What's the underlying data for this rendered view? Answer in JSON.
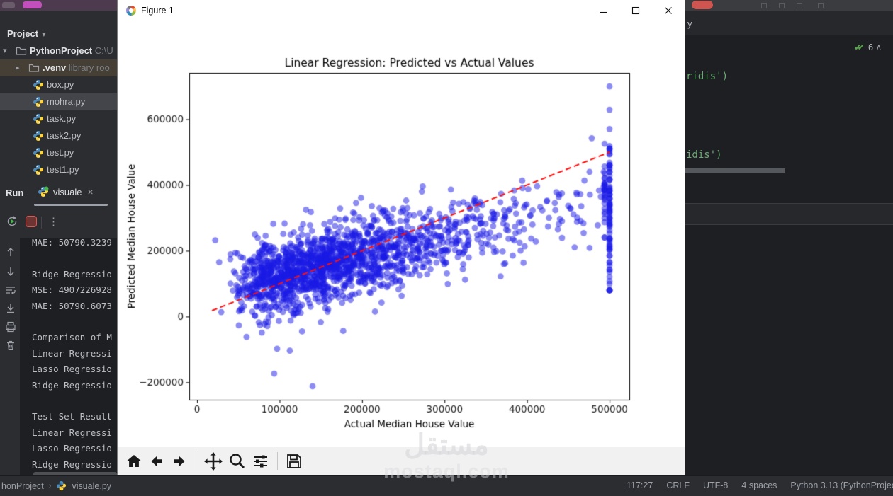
{
  "pycharm": {
    "project_panel": {
      "title": "Project",
      "items": [
        {
          "label": "PythonProject",
          "suffix": "C:\\U",
          "type": "folder",
          "depth": 0,
          "expanded": true,
          "bold": true
        },
        {
          "label": ".venv",
          "suffix": "library roo",
          "type": "folder",
          "depth": 1,
          "expanded": false,
          "bold": true,
          "highlight": "venv"
        },
        {
          "label": "box.py",
          "type": "python",
          "depth": 2
        },
        {
          "label": "mohra.py",
          "type": "python",
          "depth": 2,
          "selected": true
        },
        {
          "label": "task.py",
          "type": "python",
          "depth": 2
        },
        {
          "label": "task2.py",
          "type": "python",
          "depth": 2
        },
        {
          "label": "test.py",
          "type": "python",
          "depth": 2
        },
        {
          "label": "test1.py",
          "type": "python",
          "depth": 2
        }
      ]
    },
    "run_panel": {
      "label": "Run",
      "tab": "visuale",
      "close_tab_glyph": "×",
      "more_glyph": "⋮",
      "console_lines": [
        "MAE: 50790.3239",
        "",
        "Ridge Regressio",
        "MSE: 4907226928",
        "MAE: 50790.6073",
        "",
        "Comparison of M",
        "Linear Regressi",
        "Lasso Regressio",
        "Ridge Regressio",
        "",
        "Test Set Result",
        "Linear Regressi",
        "Lasso Regressio",
        "Ridge Regressio"
      ]
    },
    "editor": {
      "tab_tail": "y",
      "inspections_checks": "✔✔",
      "inspections_count": "6",
      "caret_up": "∧",
      "code_line_1": "ridis')",
      "code_line_2": "idis')"
    },
    "status_bar": {
      "breadcrumb_project": "honProject",
      "breadcrumb_sep": "›",
      "breadcrumb_file": "visuale.py",
      "right": [
        "117:27",
        "CRLF",
        "UTF-8",
        "4 spaces",
        "Python 3.13 (PythonProjec"
      ]
    }
  },
  "figure_window": {
    "title": "Figure 1",
    "toolbar_icons": [
      "home",
      "back",
      "forward",
      "pan",
      "zoom",
      "configure-subplots",
      "save"
    ]
  },
  "chart_data": {
    "type": "scatter",
    "title": "Linear Regression: Predicted vs Actual Values",
    "xlabel": "Actual Median House Value",
    "ylabel": "Predicted Median House Value",
    "x_ticks": [
      0,
      100000,
      200000,
      300000,
      400000,
      500000
    ],
    "y_ticks": [
      -200000,
      0,
      200000,
      400000,
      600000
    ],
    "xlim": [
      -9500,
      524000
    ],
    "ylim": [
      -253000,
      741000
    ],
    "grid": false,
    "marker_color": "#1919e6",
    "marker_alpha": 0.5,
    "marker_radius_px": 4.4,
    "identity_line": {
      "color": "#ff0f0f",
      "style": "dashed",
      "x": [
        18000,
        500000
      ],
      "y": [
        18000,
        500000
      ]
    },
    "generator": {
      "seed": 11,
      "n_cloud": 1750,
      "log_mean": 12.0,
      "log_sigma": 0.52,
      "x_min": 15000,
      "x_max": 494000,
      "slope": 0.58,
      "intercept": 68000,
      "noise_sigma": 57000,
      "y_min": -235000,
      "y_max": 700000,
      "strip": {
        "n": 85,
        "x": 500000,
        "mean": 330000,
        "sigma": 140000,
        "min": 80000,
        "max": 700000
      },
      "outliers": [
        [
          140000,
          -212000
        ],
        [
          97000,
          -98000
        ],
        [
          22000,
          232000
        ],
        [
          60000,
          -62000
        ]
      ]
    }
  },
  "watermark": {
    "arabic": "مستقل",
    "latin": "mostaql.com"
  }
}
